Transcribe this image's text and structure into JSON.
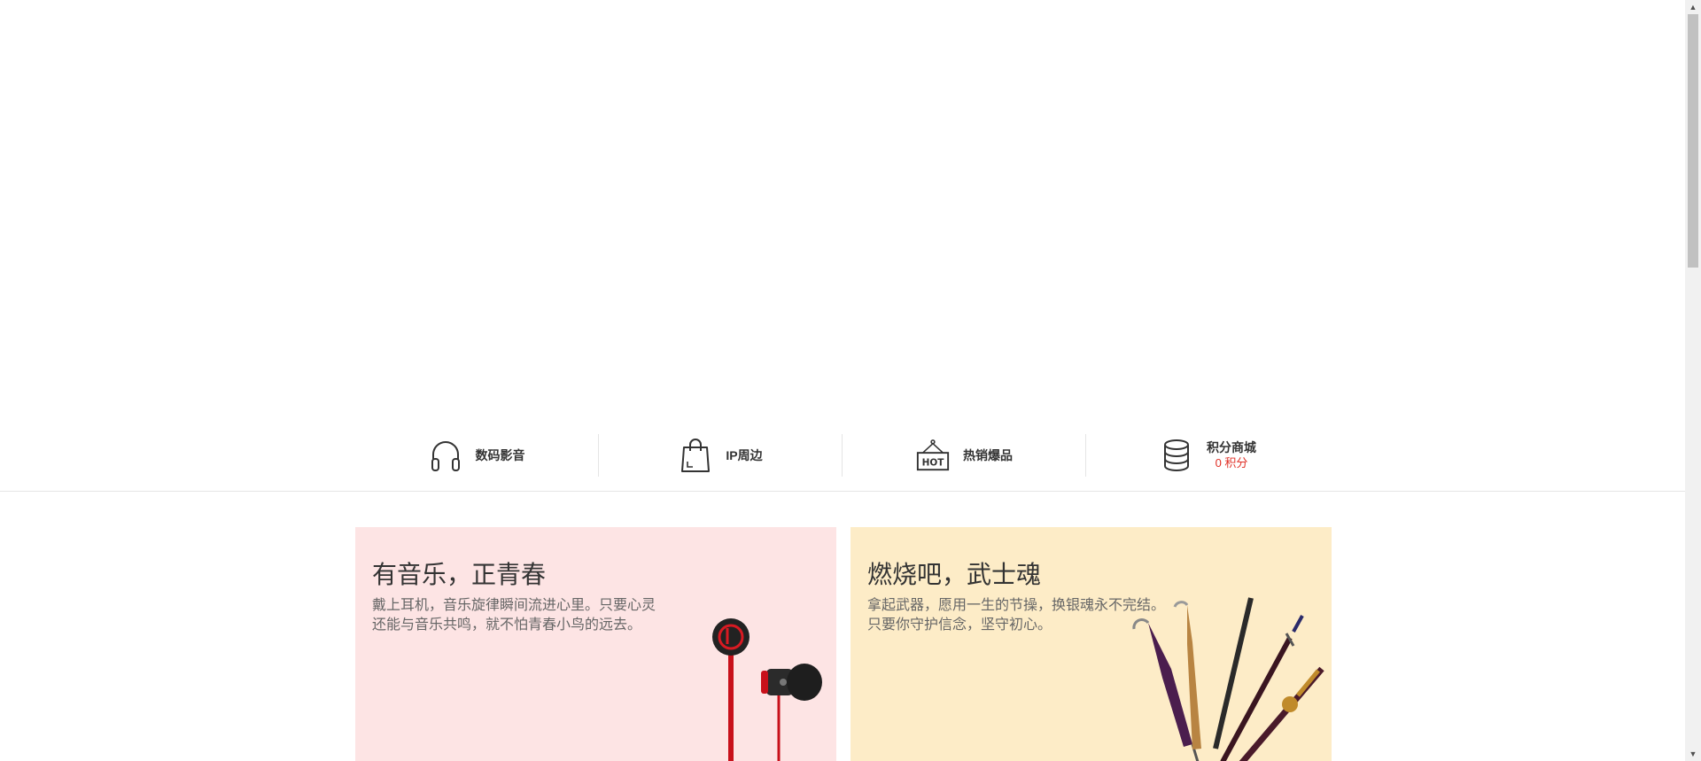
{
  "nav": {
    "items": [
      {
        "label": "数码影音",
        "icon": "headphones-icon"
      },
      {
        "label": "IP周边",
        "icon": "shopping-bag-icon"
      },
      {
        "label": "热销爆品",
        "icon": "hot-sign-icon"
      },
      {
        "label": "积分商城",
        "sub": "0 积分",
        "icon": "coin-stack-icon"
      }
    ]
  },
  "promos": [
    {
      "title": "有音乐，正青春",
      "desc": "戴上耳机，音乐旋律瞬间流进心里。只要心灵还能与音乐共鸣，就不怕青春小鸟的远去。",
      "image": "earphones-image"
    },
    {
      "title": "燃烧吧，武士魂",
      "desc": "拿起武器，愿用一生的节操，换银魂永不完结。只要你守护信念，坚守初心。",
      "image": "umbrellas-swords-image"
    }
  ],
  "colors": {
    "accent_red": "#e02e24",
    "music_bg": "#fde4e4",
    "samurai_bg": "#fdecc7",
    "divider": "#e5e5e5"
  }
}
